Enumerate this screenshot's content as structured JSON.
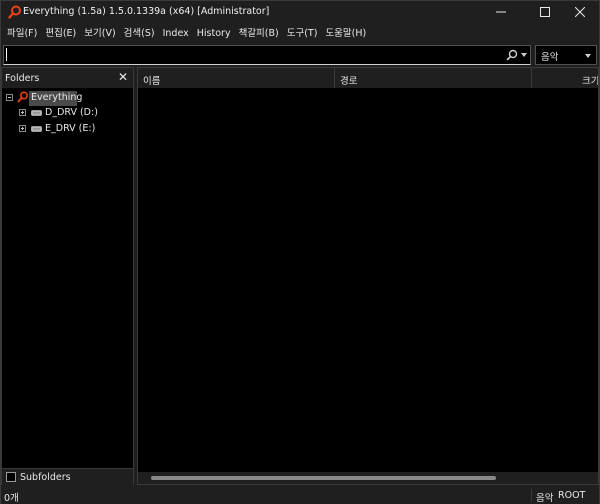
{
  "window": {
    "title": "Everything (1.5a) 1.5.0.1339a (x64) [Administrator]",
    "accent_color": "#e8411b"
  },
  "menu": [
    "파일(F)",
    "편집(E)",
    "보기(V)",
    "검색(S)",
    "Index",
    "History",
    "책갈피(B)",
    "도구(T)",
    "도움말(H)"
  ],
  "search": {
    "value": "",
    "filter_selected": "음악"
  },
  "folders": {
    "title": "Folders",
    "root_label": "Everything",
    "drives": [
      "D_DRV (D:)",
      "E_DRV (E:)"
    ],
    "subfolders_label": "Subfolders",
    "subfolders_checked": false
  },
  "results": {
    "columns": [
      "이름",
      "경로",
      "크기"
    ]
  },
  "status": {
    "count": "0개",
    "filter": "음악",
    "path": "ROOT"
  }
}
